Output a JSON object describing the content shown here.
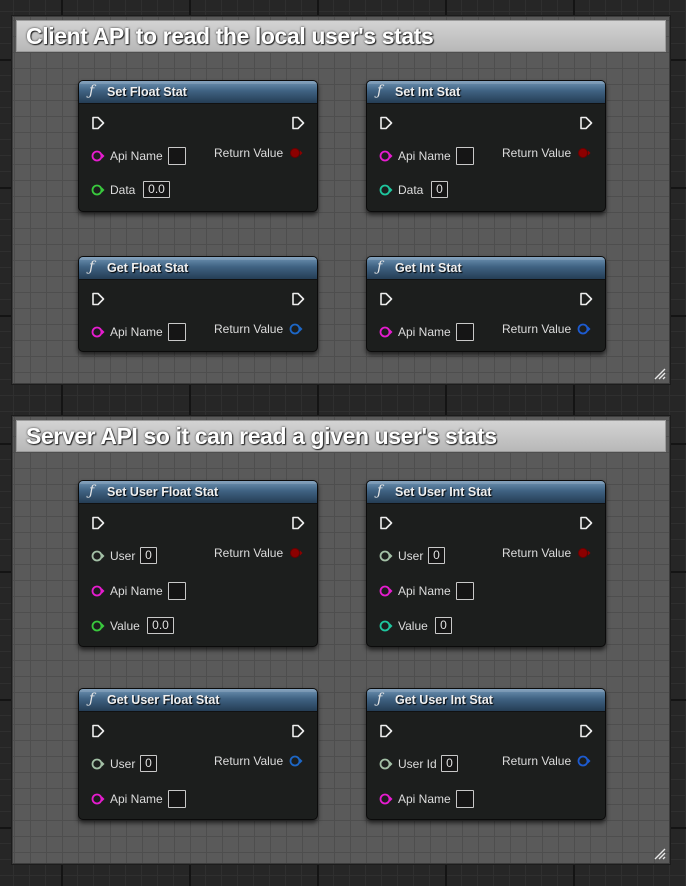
{
  "colors": {
    "string_pin": "#e61ccf",
    "float_pin": "#39c93d",
    "int_pin": "#1ec69e",
    "user_pin": "#a3c0a6",
    "bool_return": "#8c0000",
    "float_return": "#1d67c6",
    "int_return": "#1d5bd0"
  },
  "groups": [
    {
      "title": "Client API to read the local user's stats",
      "nodes": [
        {
          "title": "Set Float Stat",
          "return_label": "Return Value",
          "inputs": [
            {
              "label": "Api Name",
              "type": "string",
              "value": ""
            },
            {
              "label": "Data",
              "type": "float",
              "value": "0.0"
            }
          ]
        },
        {
          "title": "Set Int Stat",
          "return_label": "Return Value",
          "inputs": [
            {
              "label": "Api Name",
              "type": "string",
              "value": ""
            },
            {
              "label": "Data",
              "type": "int",
              "value": "0"
            }
          ]
        },
        {
          "title": "Get Float Stat",
          "return_label": "Return Value",
          "inputs": [
            {
              "label": "Api Name",
              "type": "string",
              "value": ""
            }
          ]
        },
        {
          "title": "Get Int Stat",
          "return_label": "Return Value",
          "inputs": [
            {
              "label": "Api Name",
              "type": "string",
              "value": ""
            }
          ]
        }
      ]
    },
    {
      "title": "Server API so it can read a given user's stats",
      "nodes": [
        {
          "title": "Set User Float Stat",
          "return_label": "Return Value",
          "inputs": [
            {
              "label": "User",
              "type": "user",
              "value": "0"
            },
            {
              "label": "Api Name",
              "type": "string",
              "value": ""
            },
            {
              "label": "Value",
              "type": "float",
              "value": "0.0"
            }
          ]
        },
        {
          "title": "Set User Int Stat",
          "return_label": "Return Value",
          "inputs": [
            {
              "label": "User",
              "type": "user",
              "value": "0"
            },
            {
              "label": "Api Name",
              "type": "string",
              "value": ""
            },
            {
              "label": "Value",
              "type": "int",
              "value": "0"
            }
          ]
        },
        {
          "title": "Get User Float Stat",
          "return_label": "Return Value",
          "inputs": [
            {
              "label": "User",
              "type": "user",
              "value": "0"
            },
            {
              "label": "Api Name",
              "type": "string",
              "value": ""
            }
          ]
        },
        {
          "title": "Get User Int Stat",
          "return_label": "Return Value",
          "inputs": [
            {
              "label": "User Id",
              "type": "user",
              "value": "0"
            },
            {
              "label": "Api Name",
              "type": "string",
              "value": ""
            }
          ]
        }
      ]
    }
  ]
}
